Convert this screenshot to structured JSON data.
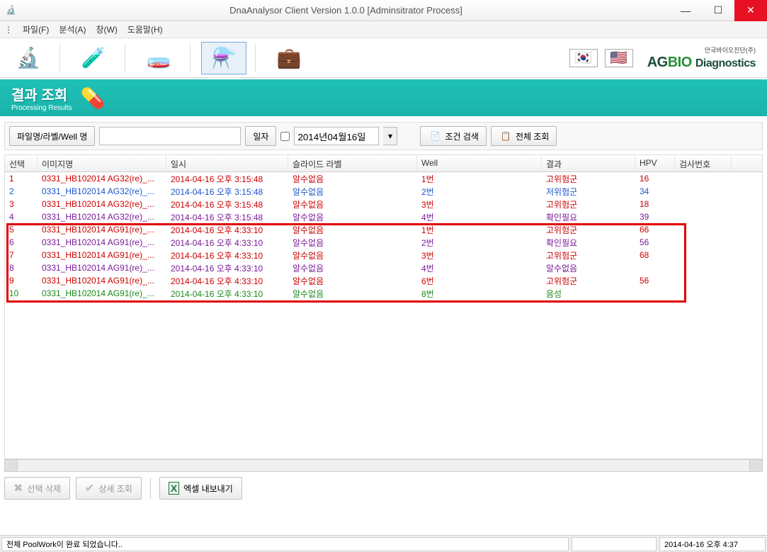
{
  "window": {
    "title": "DnaAnalysor Client Version 1.0.0 [Adminsitrator Process]"
  },
  "menu": {
    "file": "파일(F)",
    "analysis": "분석(A)",
    "window": "창(W)",
    "help": "도움말(H)"
  },
  "banner": {
    "title": "결과 조회",
    "subtitle": "Processing Results"
  },
  "logo": {
    "small": "안국바이오진단(주)",
    "ag": "AG",
    "bio": "BIO",
    "diag": "Diagnostics"
  },
  "search": {
    "filename_label": "파일명/라벨/Well 명",
    "date_label": "일자",
    "date_value": "2014년04월16일",
    "cond_search": "조건 검색",
    "view_all": "전체 조회"
  },
  "columns": {
    "select": "선택",
    "image": "이미지명",
    "datetime": "일시",
    "label": "슬라이드 라벨",
    "well": "Well",
    "result": "결과",
    "hpv": "HPV",
    "exam": "검사번호"
  },
  "rows": [
    {
      "n": "1",
      "img": "0331_HB102014 AG32(re)_...",
      "dt": "2014-04-16 오후 3:15:48",
      "lbl": "알수없음",
      "well": "1번",
      "res": "고위험군",
      "hpv": "16",
      "cls": "clr-red"
    },
    {
      "n": "2",
      "img": "0331_HB102014 AG32(re)_...",
      "dt": "2014-04-16 오후 3:15:48",
      "lbl": "알수없음",
      "well": "2번",
      "res": "저위험군",
      "hpv": "34",
      "cls": "clr-blue"
    },
    {
      "n": "3",
      "img": "0331_HB102014 AG32(re)_...",
      "dt": "2014-04-16 오후 3:15:48",
      "lbl": "알수없음",
      "well": "3번",
      "res": "고위험군",
      "hpv": "18",
      "cls": "clr-red"
    },
    {
      "n": "4",
      "img": "0331_HB102014 AG32(re)_...",
      "dt": "2014-04-16 오후 3:15:48",
      "lbl": "알수없음",
      "well": "4번",
      "res": "확인필요",
      "hpv": "39",
      "cls": "clr-purple"
    },
    {
      "n": "5",
      "img": "0331_HB102014 AG91(re)_...",
      "dt": "2014-04-16 오후 4:33:10",
      "lbl": "알수없음",
      "well": "1번",
      "res": "고위험군",
      "hpv": "66",
      "cls": "clr-red"
    },
    {
      "n": "6",
      "img": "0331_HB102014 AG91(re)_...",
      "dt": "2014-04-16 오후 4:33:10",
      "lbl": "알수없음",
      "well": "2번",
      "res": "확인필요",
      "hpv": "56",
      "cls": "clr-purple"
    },
    {
      "n": "7",
      "img": "0331_HB102014 AG91(re)_...",
      "dt": "2014-04-16 오후 4:33:10",
      "lbl": "알수없음",
      "well": "3번",
      "res": "고위험군",
      "hpv": "68",
      "cls": "clr-red"
    },
    {
      "n": "8",
      "img": "0331_HB102014 AG91(re)_...",
      "dt": "2014-04-16 오후 4:33:10",
      "lbl": "알수없음",
      "well": "4번",
      "res": "알수없음",
      "hpv": "",
      "cls": "clr-purple"
    },
    {
      "n": "9",
      "img": "0331_HB102014 AG91(re)_...",
      "dt": "2014-04-16 오후 4:33:10",
      "lbl": "알수없음",
      "well": "6번",
      "res": "고위험군",
      "hpv": "56",
      "cls": "clr-red"
    },
    {
      "n": "10",
      "img": "0331_HB102014 AG91(re)_...",
      "dt": "2014-04-16 오후 4:33:10",
      "lbl": "알수없음",
      "well": "8번",
      "res": "음성",
      "hpv": "",
      "cls": "clr-green"
    }
  ],
  "actions": {
    "delete_selected": "선택 삭제",
    "detail_view": "상세 조회",
    "export_excel": "엑셀 내보내기"
  },
  "status": {
    "message": "전체 PoolWork이 완료 되었습니다..",
    "datetime": "2014-04-16 오후 4:37"
  }
}
